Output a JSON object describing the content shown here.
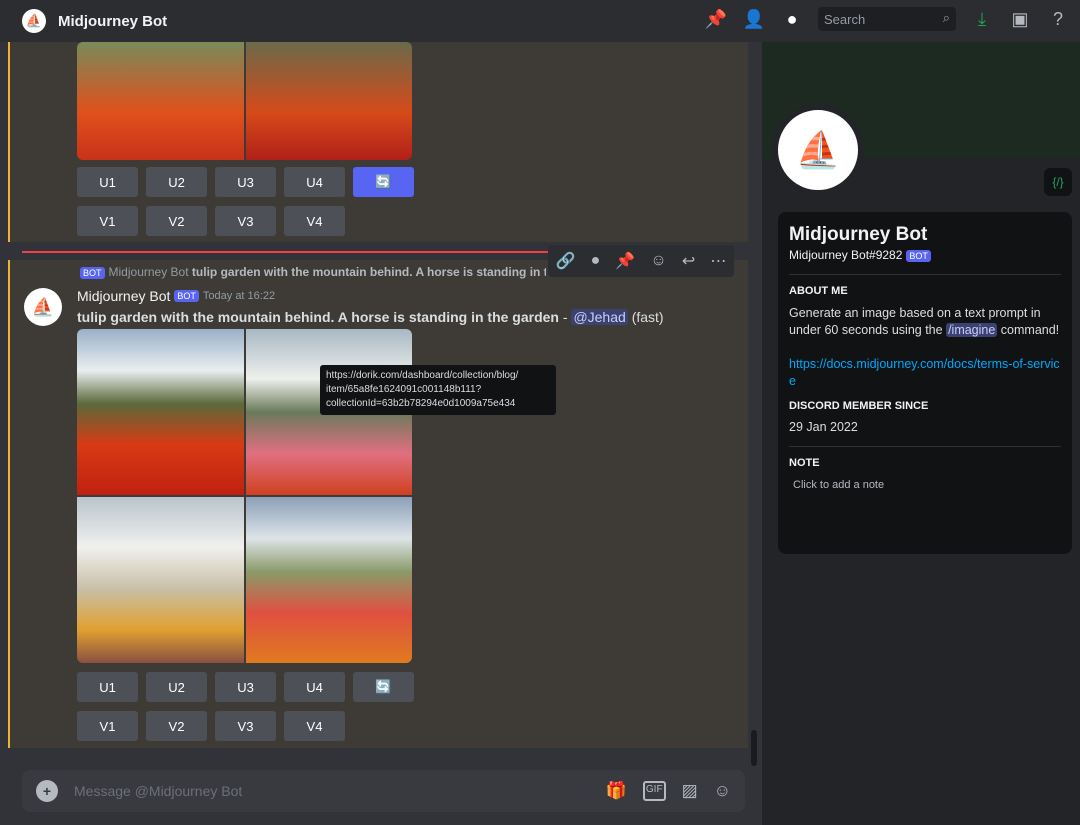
{
  "header": {
    "title": "Midjourney Bot",
    "search_placeholder": "Search"
  },
  "buttons": {
    "upscale": [
      "U1",
      "U2",
      "U3",
      "U4"
    ],
    "variation": [
      "V1",
      "V2",
      "V3",
      "V4"
    ]
  },
  "reply": {
    "badge": "BOT",
    "author": "Midjourney Bot",
    "text": "tulip garden with the mountain behind. A horse is standing in the garden"
  },
  "message": {
    "author": "Midjourney Bot",
    "badge": "BOT",
    "time": "Today at 16:22",
    "prompt": "tulip garden with the mountain behind. A horse is standing in the garden",
    "dash": " - ",
    "mention": "@Jehad",
    "mode": "(fast)"
  },
  "tooltip": {
    "line1": "https://dorik.com/dashboard/collection/blog/",
    "line2": "item/65a8fe1624091c001148b111?",
    "line3": "collectionId=63b2b78294e0d1009a75e434"
  },
  "input": {
    "placeholder": "Message @Midjourney Bot"
  },
  "profile": {
    "name": "Midjourney Bot",
    "tag": "Midjourney Bot#9282",
    "badge": "BOT",
    "about_title": "ABOUT ME",
    "about_1": "Generate an image based on a text prompt in under 60 seconds using the ",
    "about_cmd": "/imagine",
    "about_2": " command!",
    "link": "https://docs.midjourney.com/docs/terms-of-service",
    "since_title": "DISCORD MEMBER SINCE",
    "since": "29 Jan 2022",
    "note_title": "NOTE",
    "note_placeholder": "Click to add a note"
  },
  "colors": {
    "accent": "#5865f2",
    "highlight_bar": "#f0b232",
    "link": "#00a8fc"
  }
}
